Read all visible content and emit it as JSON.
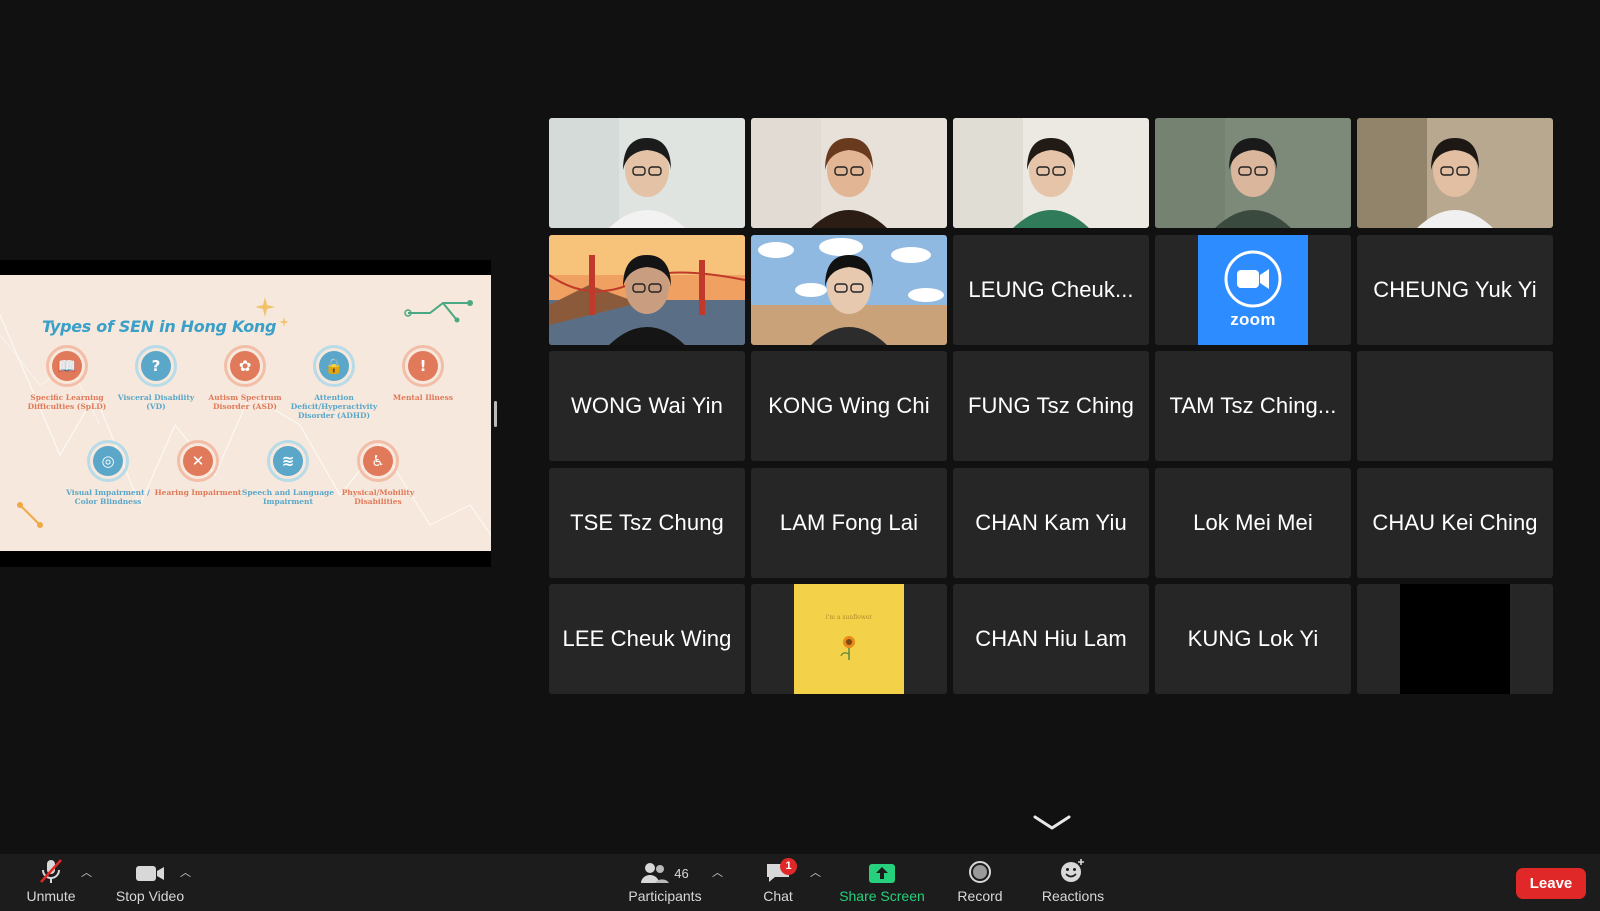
{
  "slide": {
    "title": "Types of SEN in Hong Kong",
    "row1": [
      {
        "label": "Specific Learning Difficulties (SpLD)",
        "color": "orange",
        "glyph": "📖"
      },
      {
        "label": "Visceral Disability (VD)",
        "color": "blue",
        "glyph": "?"
      },
      {
        "label": "Autism Spectrum Disorder (ASD)",
        "color": "orange",
        "glyph": "✿"
      },
      {
        "label": "Attention Deficit/Hyperactivity Disorder (ADHD)",
        "color": "blue",
        "glyph": "🔒"
      },
      {
        "label": "Mental Illness",
        "color": "orange",
        "glyph": "!"
      }
    ],
    "row2": [
      {
        "label": "Visual Impairment / Color Blindness",
        "color": "blue",
        "glyph": "◎"
      },
      {
        "label": "Hearing Impairment",
        "color": "orange",
        "glyph": "✕"
      },
      {
        "label": "Speech and Language Impairment",
        "color": "blue",
        "glyph": "≋"
      },
      {
        "label": "Physical/Mobility Disabilities",
        "color": "orange",
        "glyph": "♿"
      }
    ]
  },
  "gallery": {
    "tiles": [
      {
        "name": "",
        "kind": "video"
      },
      {
        "name": "",
        "kind": "video"
      },
      {
        "name": "",
        "kind": "video"
      },
      {
        "name": "",
        "kind": "video",
        "active": true
      },
      {
        "name": "",
        "kind": "video"
      },
      {
        "name": "",
        "kind": "video"
      },
      {
        "name": "",
        "kind": "video"
      },
      {
        "name": "LEUNG Cheuk...",
        "kind": "name"
      },
      {
        "name": "",
        "kind": "zoom-avatar"
      },
      {
        "name": "CHEUNG Yuk Yi",
        "kind": "name"
      },
      {
        "name": "WONG Wai Yin",
        "kind": "name"
      },
      {
        "name": "KONG Wing Chi",
        "kind": "name"
      },
      {
        "name": "FUNG Tsz Ching",
        "kind": "name"
      },
      {
        "name": "TAM Tsz Ching...",
        "kind": "name"
      },
      {
        "name": "",
        "kind": "empty"
      },
      {
        "name": "TSE Tsz Chung",
        "kind": "name"
      },
      {
        "name": "LAM Fong Lai",
        "kind": "name"
      },
      {
        "name": "CHAN Kam Yiu",
        "kind": "name"
      },
      {
        "name": "Lok Mei Mei",
        "kind": "name"
      },
      {
        "name": "CHAU Kei Ching",
        "kind": "name"
      },
      {
        "name": "LEE Cheuk Wing",
        "kind": "name"
      },
      {
        "name": "",
        "kind": "sunflower-avatar"
      },
      {
        "name": "CHAN Hiu Lam",
        "kind": "name"
      },
      {
        "name": "KUNG Lok Yi",
        "kind": "name"
      },
      {
        "name": "",
        "kind": "black-avatar"
      }
    ],
    "zoom_avatar_text": "zoom",
    "sunflower_text": "i'm a sunflower"
  },
  "toolbar": {
    "unmute_label": "Unmute",
    "stop_video_label": "Stop Video",
    "participants_label": "Participants",
    "participants_count": "46",
    "chat_label": "Chat",
    "chat_badge": "1",
    "share_screen_label": "Share Screen",
    "record_label": "Record",
    "reactions_label": "Reactions",
    "leave_label": "Leave"
  },
  "colors": {
    "share_green": "#26d07c",
    "leave_red": "#e02828",
    "active_speaker": "#2dd32d",
    "tile_bg": "#262626",
    "zoom_blue": "#2d8cff"
  }
}
